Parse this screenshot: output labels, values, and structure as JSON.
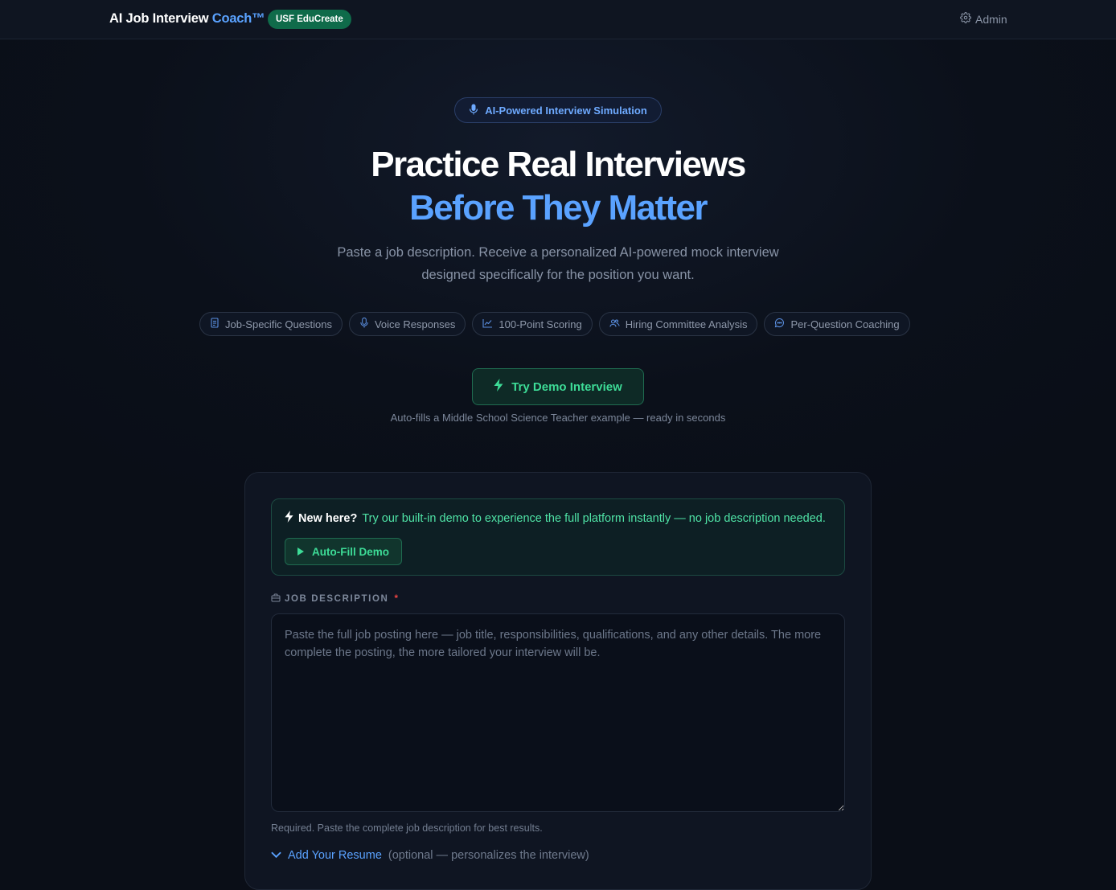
{
  "header": {
    "brand_main": "AI Job Interview",
    "brand_accent": "Coach™",
    "badge": "USF EduCreate",
    "admin_label": "Admin"
  },
  "hero": {
    "pill": "AI-Powered Interview Simulation",
    "title_line1": "Practice Real Interviews",
    "title_line2": "Before They Matter",
    "subtitle": "Paste a job description. Receive a personalized AI-powered mock interview designed specifically for the position you want.",
    "features": [
      {
        "label": "Job-Specific Questions",
        "icon": "document-icon"
      },
      {
        "label": "Voice Responses",
        "icon": "microphone-icon"
      },
      {
        "label": "100-Point Scoring",
        "icon": "chart-icon"
      },
      {
        "label": "Hiring Committee Analysis",
        "icon": "users-icon"
      },
      {
        "label": "Per-Question Coaching",
        "icon": "chat-icon"
      }
    ],
    "demo_button": "Try Demo Interview",
    "demo_caption": "Auto-fills a Middle School Science Teacher example — ready in seconds"
  },
  "form": {
    "new_here_bold": "New here?",
    "new_here_text": "Try our built-in demo to experience the full platform instantly — no job description needed.",
    "autofill_button": "Auto-Fill Demo",
    "jd_label": "JOB DESCRIPTION",
    "jd_required_mark": "*",
    "jd_placeholder": "Paste the full job posting here — job title, responsibilities, qualifications, and any other details. The more complete the posting, the more tailored your interview will be.",
    "jd_value": "",
    "jd_help": "Required. Paste the complete job description for best results.",
    "resume_link": "Add Your Resume",
    "resume_note": "(optional — personalizes the interview)"
  },
  "colors": {
    "accent_blue": "#5aa2ff",
    "accent_green": "#3ddc97",
    "badge_green": "#0f6b4a",
    "required_red": "#ef4444",
    "background": "#0a0e17"
  }
}
